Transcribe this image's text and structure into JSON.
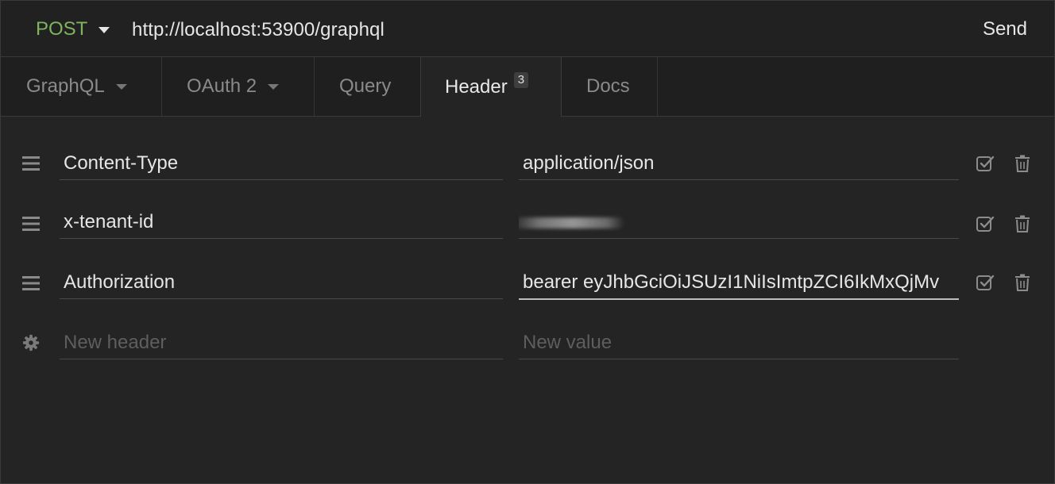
{
  "request": {
    "method": "POST",
    "url": "http://localhost:53900/graphql",
    "send_label": "Send"
  },
  "tabs": [
    {
      "label": "GraphQL",
      "dropdown": true
    },
    {
      "label": "OAuth 2",
      "dropdown": true
    },
    {
      "label": "Query",
      "dropdown": false
    },
    {
      "label": "Header",
      "badge": "3",
      "active": true
    },
    {
      "label": "Docs",
      "dropdown": false
    }
  ],
  "headers": [
    {
      "name": "Content-Type",
      "value": "application/json",
      "enabled": true
    },
    {
      "name": "x-tenant-id",
      "value_redacted": true,
      "enabled": true
    },
    {
      "name": "Authorization",
      "value": "bearer eyJhbGciOiJSUzI1NiIsImtpZCI6IkMxQjMv",
      "enabled": true
    }
  ],
  "new_row": {
    "name_placeholder": "New header",
    "value_placeholder": "New value"
  },
  "colors": {
    "method": "#7fb45f",
    "background": "#242424",
    "text": "#e6e6e6",
    "muted": "#8a8a8a"
  },
  "icons": {
    "row_handle": "drag-handle-icon",
    "enabled": "checkbox-checked-icon",
    "delete": "trash-icon",
    "new_row": "gear-icon"
  }
}
